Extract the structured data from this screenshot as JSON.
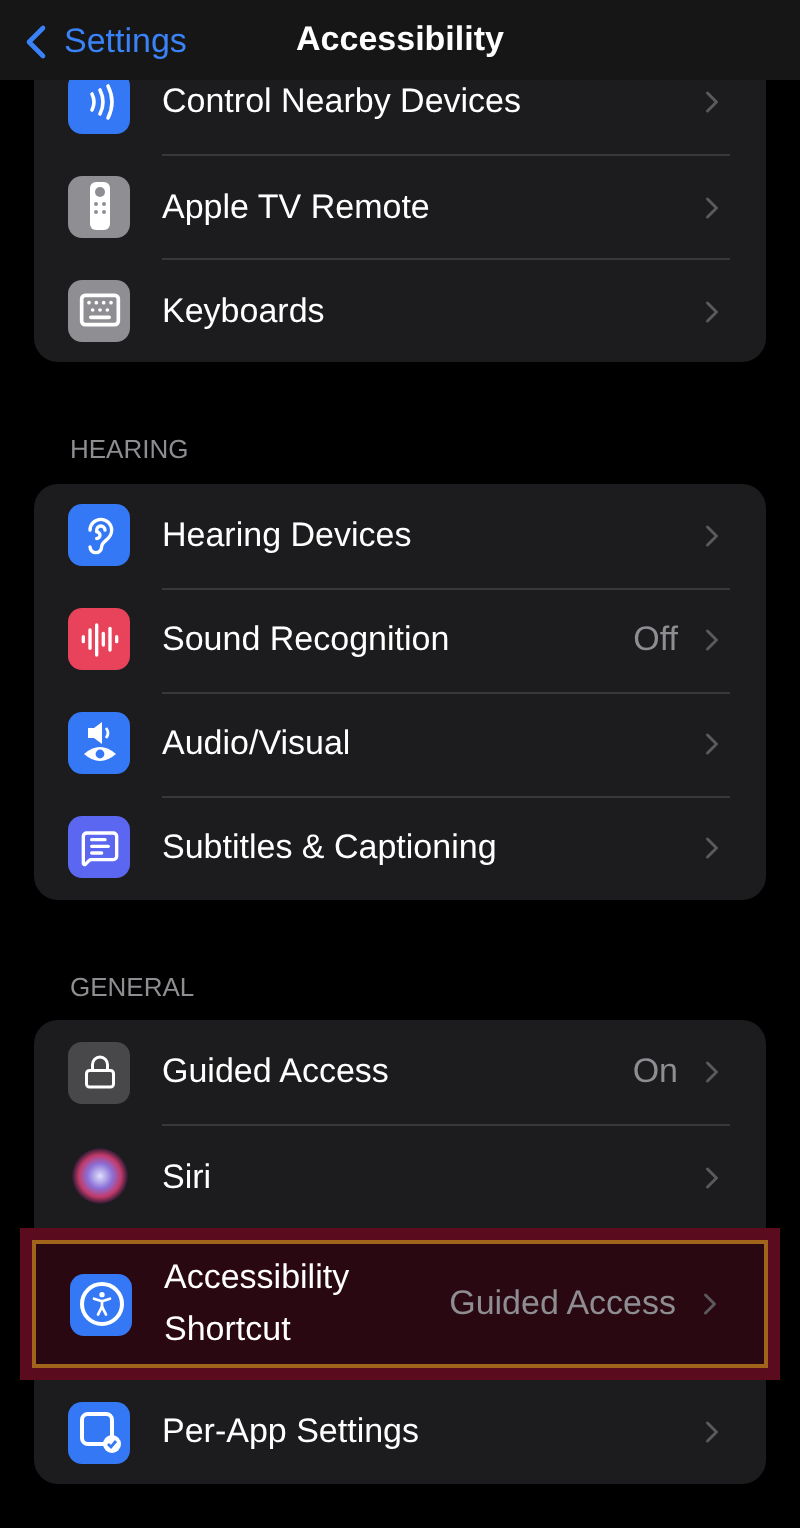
{
  "nav": {
    "back": "Settings",
    "title": "Accessibility"
  },
  "groups": [
    {
      "items": [
        {
          "kind": "nearby",
          "color": "#3478f6",
          "label": "Control Nearby Devices",
          "value": null,
          "highlighted": false
        },
        {
          "kind": "remote",
          "color": "#8e8e93",
          "label": "Apple TV Remote",
          "value": null,
          "highlighted": false
        },
        {
          "kind": "keyboard",
          "color": "#8e8e93",
          "label": "Keyboards",
          "value": null,
          "highlighted": false
        }
      ]
    },
    {
      "header": "HEARING",
      "items": [
        {
          "kind": "ear",
          "color": "#3478f6",
          "label": "Hearing Devices",
          "value": null,
          "highlighted": false
        },
        {
          "kind": "sound",
          "color": "#e8435a",
          "label": "Sound Recognition",
          "value": "Off",
          "highlighted": false
        },
        {
          "kind": "audiovisual",
          "color": "#3478f6",
          "label": "Audio/Visual",
          "value": null,
          "highlighted": false
        },
        {
          "kind": "subtitles",
          "color": "#5b67f0",
          "label": "Subtitles & Captioning",
          "value": null,
          "highlighted": false
        }
      ]
    },
    {
      "header": "GENERAL",
      "items": [
        {
          "kind": "lock",
          "color": "#48484a",
          "label": "Guided Access",
          "value": "On",
          "highlighted": false
        },
        {
          "kind": "siri",
          "label": "Siri",
          "value": null,
          "highlighted": false
        },
        {
          "kind": "accessibility",
          "color": "#3478f6",
          "label": "Accessibility Shortcut",
          "value": "Guided Access",
          "highlighted": true
        },
        {
          "kind": "perapp",
          "color": "#3478f6",
          "label": "Per-App Settings",
          "value": null,
          "highlighted": false
        }
      ]
    }
  ]
}
